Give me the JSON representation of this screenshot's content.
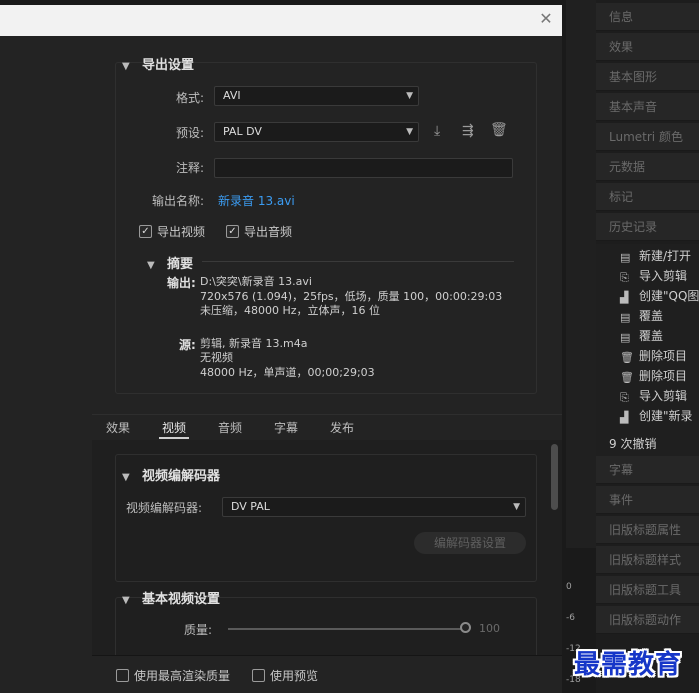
{
  "export_settings": {
    "section_title": "导出设置",
    "format_label": "格式:",
    "format_value": "AVI",
    "preset_label": "预设:",
    "preset_value": "PAL DV",
    "comment_label": "注释:",
    "output_name_label": "输出名称:",
    "output_name_value": "新录音 13.avi",
    "export_video_label": "导出视频",
    "export_audio_label": "导出音频"
  },
  "summary": {
    "title": "摘要",
    "output_key": "输出:",
    "output_lines": [
      "D:\\突突\\新录音 13.avi",
      "720x576 (1.094)，25fps，低场，质量 100，00:00:29:03",
      "未压缩，48000 Hz，立体声，16 位"
    ],
    "source_key": "源:",
    "source_lines": [
      "剪辑, 新录音 13.m4a",
      "无视频",
      "48000 Hz，单声道，00;00;29;03"
    ]
  },
  "tabs": [
    "效果",
    "视频",
    "音频",
    "字幕",
    "发布"
  ],
  "video_codec": {
    "section_title": "视频编解码器",
    "codec_label": "视频编解码器:",
    "codec_value": "DV PAL",
    "codec_settings_button": "编解码器设置"
  },
  "basic_video": {
    "section_title": "基本视频设置",
    "quality_label": "质量:",
    "quality_value": "100"
  },
  "footer": {
    "max_render_quality": "使用最高渲染质量",
    "use_previews": "使用预览"
  },
  "right_panel": {
    "top_items": [
      "信息",
      "效果",
      "基本图形",
      "基本声音",
      "Lumetri 颜色",
      "元数据",
      "标记",
      "历史记录"
    ],
    "history_items": [
      "新建/打开",
      "导入剪辑",
      "创建\"QQ图",
      "覆盖",
      "覆盖",
      "删除项目",
      "删除项目",
      "导入剪辑",
      "创建\"新录"
    ],
    "undo_count": "9 次撤销",
    "bottom_items": [
      "字幕",
      "事件",
      "旧版标题属性",
      "旧版标题样式",
      "旧版标题工具",
      "旧版标题动作"
    ]
  },
  "ruler": [
    "0",
    "-6",
    "-12",
    "-18"
  ],
  "watermark": "最需教育"
}
